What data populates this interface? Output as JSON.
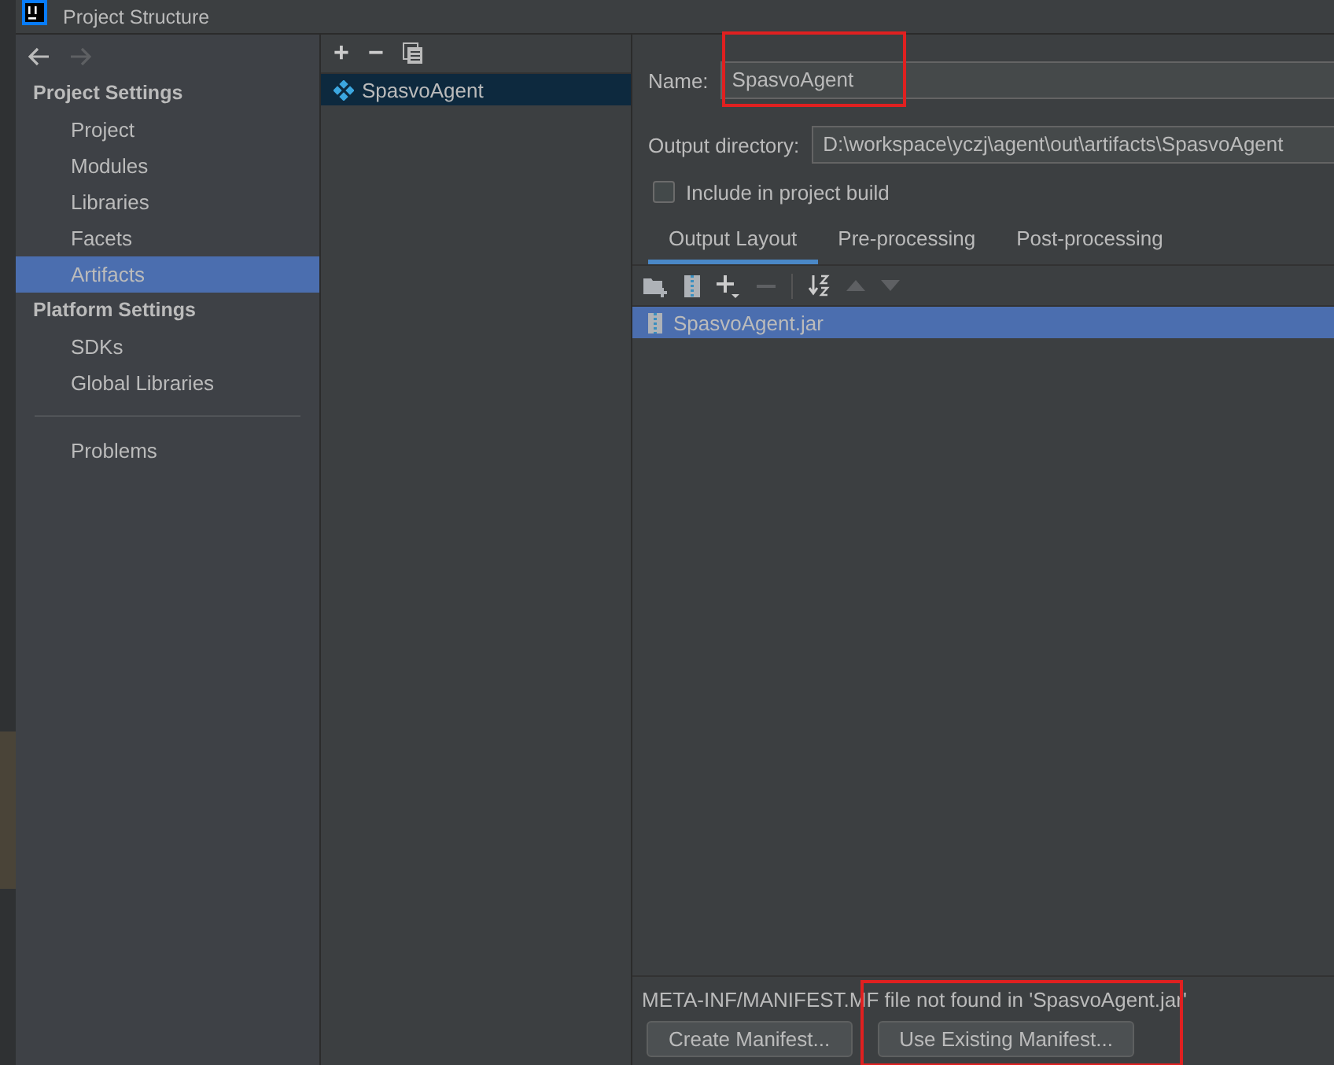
{
  "window": {
    "title": "Project Structure"
  },
  "sidebar": {
    "sections": [
      {
        "title": "Project Settings",
        "items": [
          {
            "label": "Project",
            "selected": false
          },
          {
            "label": "Modules",
            "selected": false
          },
          {
            "label": "Libraries",
            "selected": false
          },
          {
            "label": "Facets",
            "selected": false
          },
          {
            "label": "Artifacts",
            "selected": true
          }
        ]
      },
      {
        "title": "Platform Settings",
        "items": [
          {
            "label": "SDKs",
            "selected": false
          },
          {
            "label": "Global Libraries",
            "selected": false
          }
        ]
      }
    ],
    "footer_items": [
      {
        "label": "Problems",
        "selected": false
      }
    ]
  },
  "artifacts": {
    "toolbar": [
      "+",
      "−"
    ],
    "items": [
      {
        "label": "SpasvoAgent",
        "selected": true
      }
    ]
  },
  "detail": {
    "name_label": "Name:",
    "name_value": "SpasvoAgent",
    "output_label": "Output directory:",
    "output_value": "D:\\workspace\\yczj\\agent\\out\\artifacts\\SpasvoAgent",
    "include_build": {
      "label": "Include in project build",
      "checked": false
    },
    "tabs": [
      {
        "label": "Output Layout",
        "selected": true
      },
      {
        "label": "Pre-processing",
        "selected": false
      },
      {
        "label": "Post-processing",
        "selected": false
      }
    ],
    "layout_items": [
      {
        "label": "SpasvoAgent.jar",
        "selected": true
      }
    ],
    "message": "META-INF/MANIFEST.MF file not found in 'SpasvoAgent.jar'",
    "buttons": [
      "Create Manifest...",
      "Use Existing Manifest..."
    ]
  }
}
